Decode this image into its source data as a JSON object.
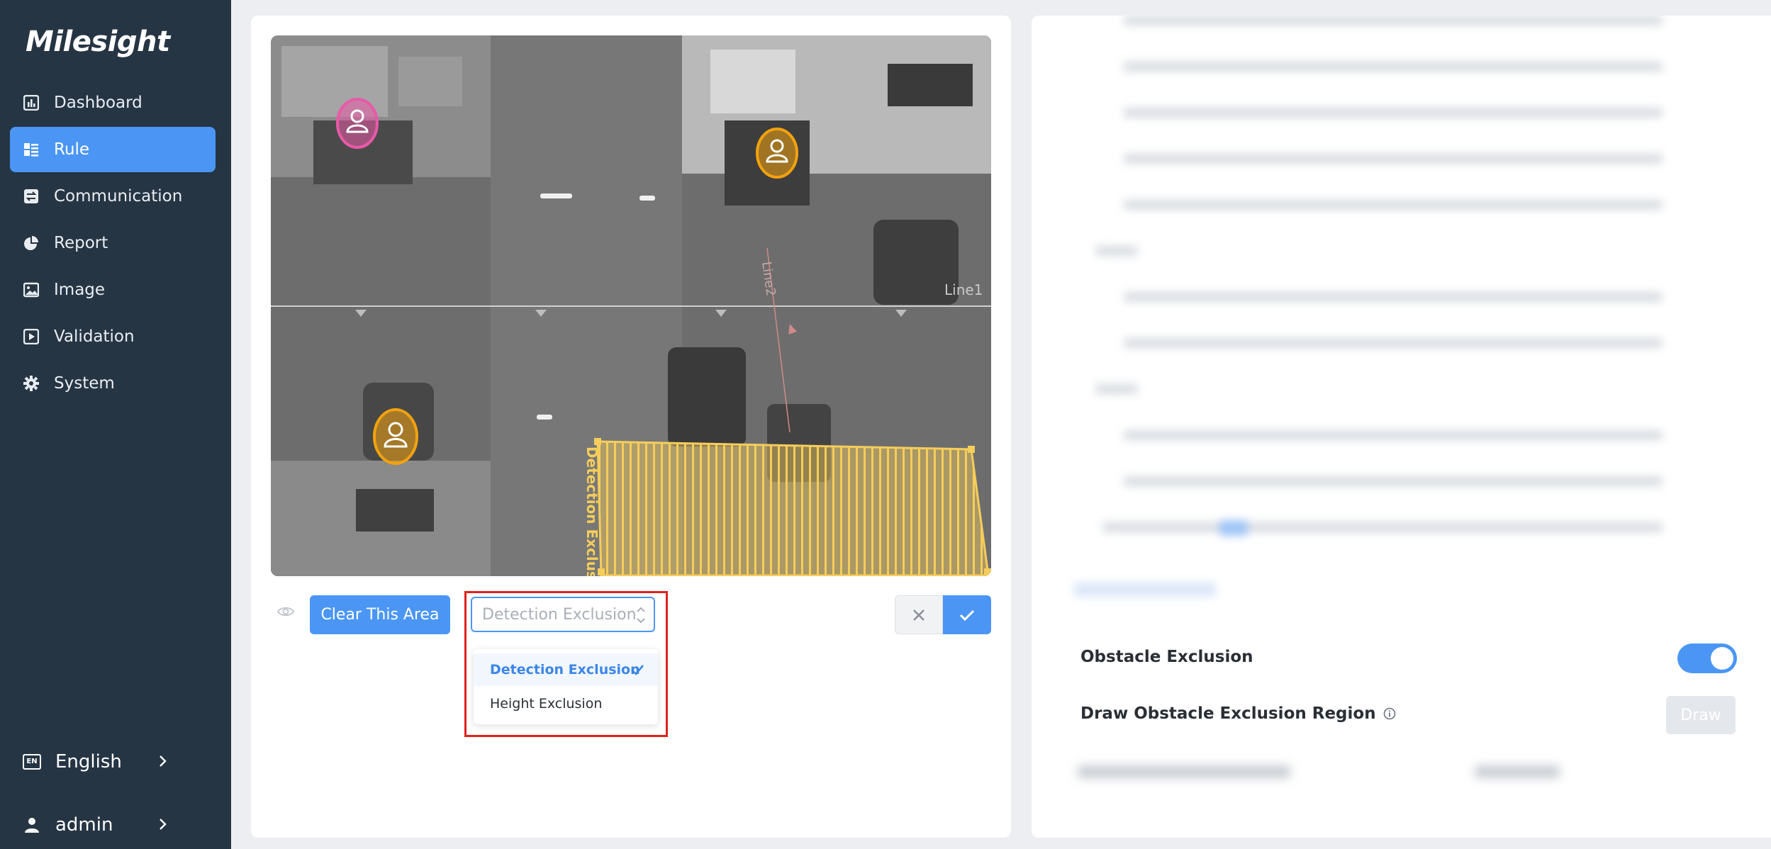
{
  "brand": {
    "name": "Milesight"
  },
  "sidebar": {
    "items": [
      {
        "label": "Dashboard",
        "icon": "bar-chart-icon",
        "active": false
      },
      {
        "label": "Rule",
        "icon": "grid-list-icon",
        "active": true
      },
      {
        "label": "Communication",
        "icon": "transfer-icon",
        "active": false
      },
      {
        "label": "Report",
        "icon": "pie-chart-icon",
        "active": false
      },
      {
        "label": "Image",
        "icon": "image-icon",
        "active": false
      },
      {
        "label": "Validation",
        "icon": "play-doc-icon",
        "active": false
      },
      {
        "label": "System",
        "icon": "gear-icon",
        "active": false
      }
    ],
    "language": {
      "label": "English",
      "badge": "EN"
    },
    "user": {
      "label": "admin"
    }
  },
  "camera": {
    "line1_label": "Line1",
    "line2_label": "Line2",
    "exclusion_label": "Detection Exclusion"
  },
  "toolbar": {
    "clear_label": "Clear This Area",
    "select": {
      "placeholder": "Detection Exclusion",
      "options": [
        {
          "label": "Detection Exclusion",
          "selected": true
        },
        {
          "label": "Height Exclusion",
          "selected": false
        }
      ]
    }
  },
  "settings": {
    "obstacle_exclusion": {
      "label": "Obstacle Exclusion",
      "enabled": true
    },
    "draw_region": {
      "label": "Draw Obstacle Exclusion Region",
      "button": "Draw"
    }
  },
  "colors": {
    "sidebar_bg": "#263544",
    "accent": "#4b96f4",
    "exclusion_yellow": "#f5cd5b",
    "person_orange": "#f2a20f",
    "person_pink": "#e85aa8",
    "highlight_red": "#e02020"
  }
}
